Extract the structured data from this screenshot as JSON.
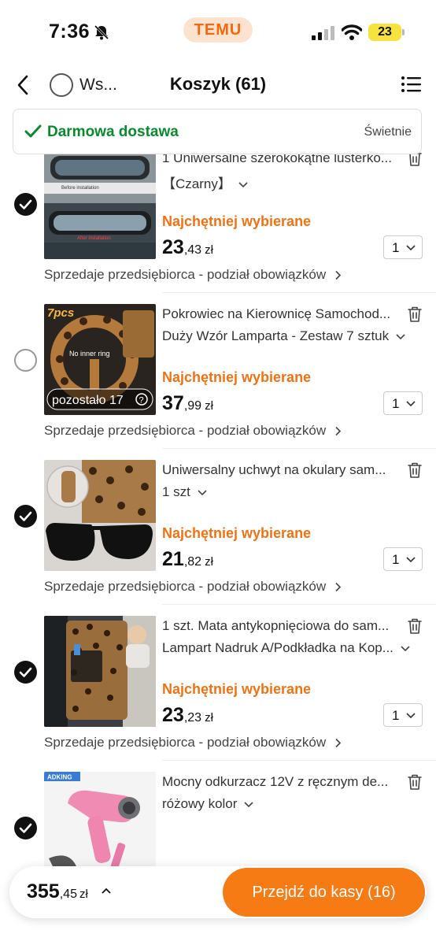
{
  "status_bar": {
    "time": "7:36",
    "app_badge": "TEMU",
    "battery": "23"
  },
  "header": {
    "select_all_label": "Ws...",
    "title": "Koszyk (61)"
  },
  "banner": {
    "text": "Darmowa dostawa",
    "right_text": "Świetnie"
  },
  "colors": {
    "accent": "#f77b14",
    "badge_orange": "#f27213",
    "free_shipping_green": "#0a8a2e"
  },
  "items": [
    {
      "title": "1 Uniwersalne szerokokątne lusterko...",
      "variant": "【Czarny】",
      "badge": "Najchętniej wybierane",
      "price_int": "23",
      "price_dec": ",43",
      "currency": "zł",
      "quantity": "1",
      "seller": "Sprzedaje przedsiębiorca - podział obowiązków",
      "checked": true,
      "image_labels": [
        "Before installation",
        "After installation"
      ]
    },
    {
      "title": "Pokrowiec na Kierownicę Samochod...",
      "variant": "Duży Wzór Lamparta - Zestaw 7 sztuk",
      "badge": "Najchętniej wybierane",
      "price_int": "37",
      "price_dec": ",99",
      "currency": "zł",
      "quantity": "1",
      "seller": "Sprzedaje przedsiębiorca - podział obowiązków",
      "checked": false,
      "image_labels": [
        "7pcs",
        "No inner ring",
        "pozostało 17"
      ]
    },
    {
      "title": "Uniwersalny uchwyt na okulary sam...",
      "variant": "1 szt",
      "badge": "Najchętniej wybierane",
      "price_int": "21",
      "price_dec": ",82",
      "currency": "zł",
      "quantity": "1",
      "seller": "Sprzedaje przedsiębiorca - podział obowiązków",
      "checked": true,
      "image_labels": []
    },
    {
      "title": "1 szt. Mata antykopnięciowa do sam...",
      "variant": "Lampart Nadruk A/Podkładka na Kop...",
      "badge": "Najchętniej wybierane",
      "price_int": "23",
      "price_dec": ",23",
      "currency": "zł",
      "quantity": "1",
      "seller": "Sprzedaje przedsiębiorca - podział obowiązków",
      "checked": true,
      "image_labels": []
    },
    {
      "title": "Mocny odkurzacz 12V z ręcznym de...",
      "variant": "różowy kolor",
      "badge": "",
      "price_int": "",
      "price_dec": "",
      "currency": "",
      "quantity": "",
      "seller": "",
      "checked": true,
      "image_labels": [
        "ADKING"
      ]
    }
  ],
  "footer": {
    "total_int": "355",
    "total_dec": ",45",
    "currency": "zł",
    "checkout_label": "Przejdź do kasy (16)"
  }
}
